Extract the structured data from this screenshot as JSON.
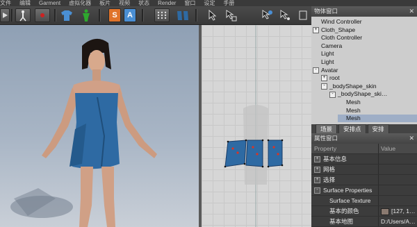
{
  "menubar": [
    "文件",
    "编辑",
    "Garment",
    "虚拟化器",
    "板片",
    "视频",
    "状态",
    "Render",
    "窗口",
    "设定",
    "手册"
  ],
  "object_window": {
    "title": "物体窗口",
    "nodes": [
      {
        "label": "Wind Controller",
        "indent": 1,
        "toggle": ""
      },
      {
        "label": "Cloth_Shape",
        "indent": 1,
        "toggle": "+"
      },
      {
        "label": "Cloth Controller",
        "indent": 1,
        "toggle": ""
      },
      {
        "label": "Camera",
        "indent": 1,
        "toggle": ""
      },
      {
        "label": "Light",
        "indent": 1,
        "toggle": ""
      },
      {
        "label": "Light",
        "indent": 1,
        "toggle": ""
      },
      {
        "label": "Avatar",
        "indent": 1,
        "toggle": "-"
      },
      {
        "label": "root",
        "indent": 2,
        "toggle": "+"
      },
      {
        "label": "_bodyShape_skin",
        "indent": 2,
        "toggle": "-"
      },
      {
        "label": "_bodyShape_ski…",
        "indent": 3,
        "toggle": "-"
      },
      {
        "label": "Mesh",
        "indent": 4,
        "toggle": ""
      },
      {
        "label": "Mesh",
        "indent": 4,
        "toggle": ""
      },
      {
        "label": "Mesh",
        "indent": 4,
        "toggle": "",
        "selected": true
      }
    ],
    "tabs": [
      "场景",
      "安排点",
      "安排"
    ]
  },
  "property_window": {
    "title": "属性窗口",
    "header": {
      "property": "Property",
      "value": "Value"
    },
    "rows": [
      {
        "label": "基本信息",
        "toggle": "+",
        "value": ""
      },
      {
        "label": "网格",
        "toggle": "+",
        "value": ""
      },
      {
        "label": "选择",
        "toggle": "+",
        "value": ""
      },
      {
        "label": "Surface Properties",
        "toggle": "-",
        "value": ""
      },
      {
        "label": "Surface Texture",
        "toggle": "",
        "value": ""
      },
      {
        "label": "基本的颜色",
        "toggle": "",
        "value": "[127, 1…"
      },
      {
        "label": "基本地图",
        "toggle": "",
        "value": "D:/Users/A…"
      }
    ]
  },
  "colors": {
    "dress": "#2e6aa3",
    "panel_bg": "#3c3c3c",
    "tree_bg": "#cdcdcd",
    "selected": "#9eaec6",
    "tool_orange": "#e0732a",
    "tool_blue": "#4a8fd4"
  }
}
